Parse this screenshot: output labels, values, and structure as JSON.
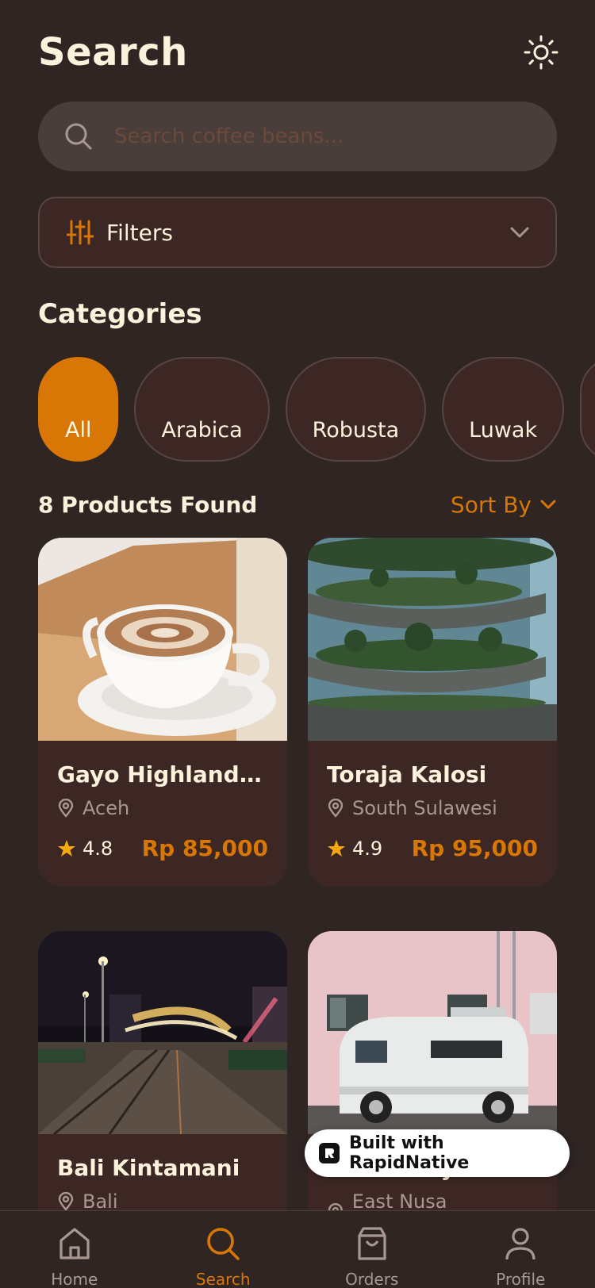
{
  "header": {
    "title": "Search"
  },
  "search": {
    "placeholder": "Search coffee beans..."
  },
  "filters": {
    "label": "Filters"
  },
  "categories": {
    "title": "Categories",
    "items": [
      {
        "label": "All",
        "active": true
      },
      {
        "label": "Arabica",
        "active": false
      },
      {
        "label": "Robusta",
        "active": false
      },
      {
        "label": "Luwak",
        "active": false
      }
    ]
  },
  "results": {
    "count_label": "8 Products Found",
    "sort_label": "Sort By"
  },
  "products": [
    {
      "name": "Gayo Highland A...",
      "location": "Aceh",
      "rating": "4.8",
      "price": "Rp 85,000",
      "image": "latte-art-photo"
    },
    {
      "name": "Toraja Kalosi",
      "location": "South Sulawesi",
      "rating": "4.9",
      "price": "Rp 95,000",
      "image": "garden-building-photo"
    },
    {
      "name": "Bali Kintamani",
      "location": "Bali",
      "rating": "",
      "price": "",
      "image": "night-street-photo"
    },
    {
      "name": "Flores Bajawa",
      "location": "East Nusa Tenggara",
      "rating": "",
      "price": "",
      "image": "white-van-photo"
    }
  ],
  "badge": {
    "label": "Built with RapidNative"
  },
  "tabbar": {
    "items": [
      {
        "label": "Home",
        "icon": "home-icon",
        "active": false
      },
      {
        "label": "Search",
        "icon": "search-icon",
        "active": true
      },
      {
        "label": "Orders",
        "icon": "bag-icon",
        "active": false
      },
      {
        "label": "Profile",
        "icon": "user-icon",
        "active": false
      }
    ]
  },
  "colors": {
    "background": "#2f2523",
    "card": "#3d2724",
    "accent": "#d97706",
    "text": "#fdf2dc",
    "muted": "#a89891"
  }
}
